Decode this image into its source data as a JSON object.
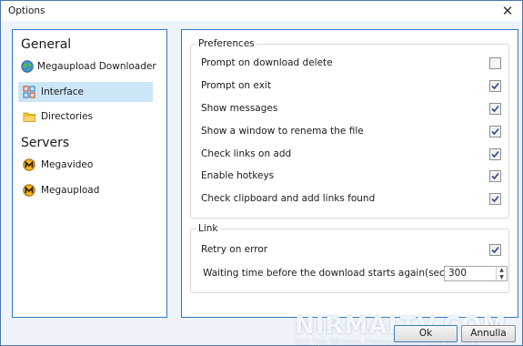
{
  "window": {
    "title": "Options",
    "close_glyph": "✕"
  },
  "sidebar": {
    "sections": [
      {
        "title": "General",
        "items": [
          {
            "label": "Megaupload Downloader",
            "icon": "globe-icon",
            "selected": false
          },
          {
            "label": "Interface",
            "icon": "grid-icon",
            "selected": true
          },
          {
            "label": "Directories",
            "icon": "folder-icon",
            "selected": false
          }
        ]
      },
      {
        "title": "Servers",
        "items": [
          {
            "label": "Megavideo",
            "icon": "megavideo-logo-icon",
            "selected": false
          },
          {
            "label": "Megaupload",
            "icon": "megaupload-logo-icon",
            "selected": false
          }
        ]
      }
    ]
  },
  "preferences": {
    "title": "Preferences",
    "options": [
      {
        "label": "Prompt on download delete",
        "checked": false
      },
      {
        "label": "Prompt on exit",
        "checked": true
      },
      {
        "label": "Show messages",
        "checked": true
      },
      {
        "label": "Show a window to renema the file",
        "checked": true
      },
      {
        "label": "Check links on add",
        "checked": true
      },
      {
        "label": "Enable hotkeys",
        "checked": true
      },
      {
        "label": "Check clipboard and add links found",
        "checked": true
      }
    ]
  },
  "link": {
    "title": "Link",
    "retry_label": "Retry on error",
    "retry_checked": true,
    "wait_label": "Waiting time before the download starts again(sec)",
    "wait_value": "300"
  },
  "buttons": {
    "ok": "Ok",
    "cancel": "Annulla"
  },
  "watermark": {
    "main": "NIRMALTV.COM",
    "sub": "Tech Tips, Windows, Freeware, Social Media and more"
  },
  "colors": {
    "accent_border": "#2f78c9",
    "selected_bg": "#cce6f8",
    "client_bg": "#eef3fa"
  }
}
